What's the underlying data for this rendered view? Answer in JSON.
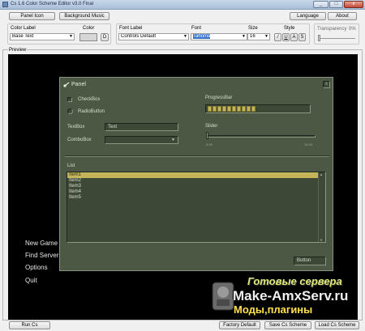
{
  "window": {
    "title": "Cs 1.6 Color Scheme Editor v3.0 Final",
    "minimize": "_",
    "maximize": "□",
    "close": "x"
  },
  "toolbar": {
    "panel_icon": "Panel Icon",
    "background_music": "Background Music",
    "language": "Language",
    "about": "About"
  },
  "color_group": {
    "color_label_caption": "Color Label",
    "color_label_value": "Base Text",
    "color_caption": "Color",
    "color_swatch": "#d6d6d6",
    "pick_button": "D"
  },
  "font_group": {
    "font_label_caption": "Font Label",
    "font_label_value": "Controls Default",
    "font_caption": "Font",
    "font_value": "Tahoma",
    "size_caption": "Size",
    "size_value": "16",
    "style_caption": "Style",
    "style_buttons": [
      "/",
      "U",
      "A",
      "S"
    ]
  },
  "transparency": {
    "caption": "Transparency",
    "value": "0%"
  },
  "preview": {
    "caption": "Preview",
    "menu": [
      "New Game",
      "Find Servers",
      "Options",
      "Quit"
    ],
    "panel": {
      "title": "Panel",
      "close": "x",
      "checkbox": "CheckBox",
      "radiobutton": "RadioButton",
      "progressbar": "ProgressBar",
      "progress_fraction": 0.5,
      "textbox_label": "TextBox",
      "textbox_value": "Text",
      "slider_label": "Slider",
      "slider_min": "0.00",
      "slider_max": "10.00",
      "slider_value": 0,
      "combobox_label": "ComboBox",
      "list_label": "List",
      "list_items": [
        "Item1",
        "Item2",
        "Item3",
        "Item4",
        "Item5"
      ],
      "selected_index": 0,
      "button": "Button"
    }
  },
  "watermark": {
    "line1": "Готовые сервера",
    "line2": "Make-AmxServ.ru",
    "line3": "Моды,плагины"
  },
  "bottom": {
    "run_cs": "Run Cs",
    "factory_default": "Factory Default",
    "save_scheme": "Save Cs Scheme",
    "load_scheme": "Load Cs Scheme"
  },
  "colors": {
    "panel_bg": "#4c5844",
    "accent": "#c4b55a",
    "preview_bg": "#000000"
  }
}
